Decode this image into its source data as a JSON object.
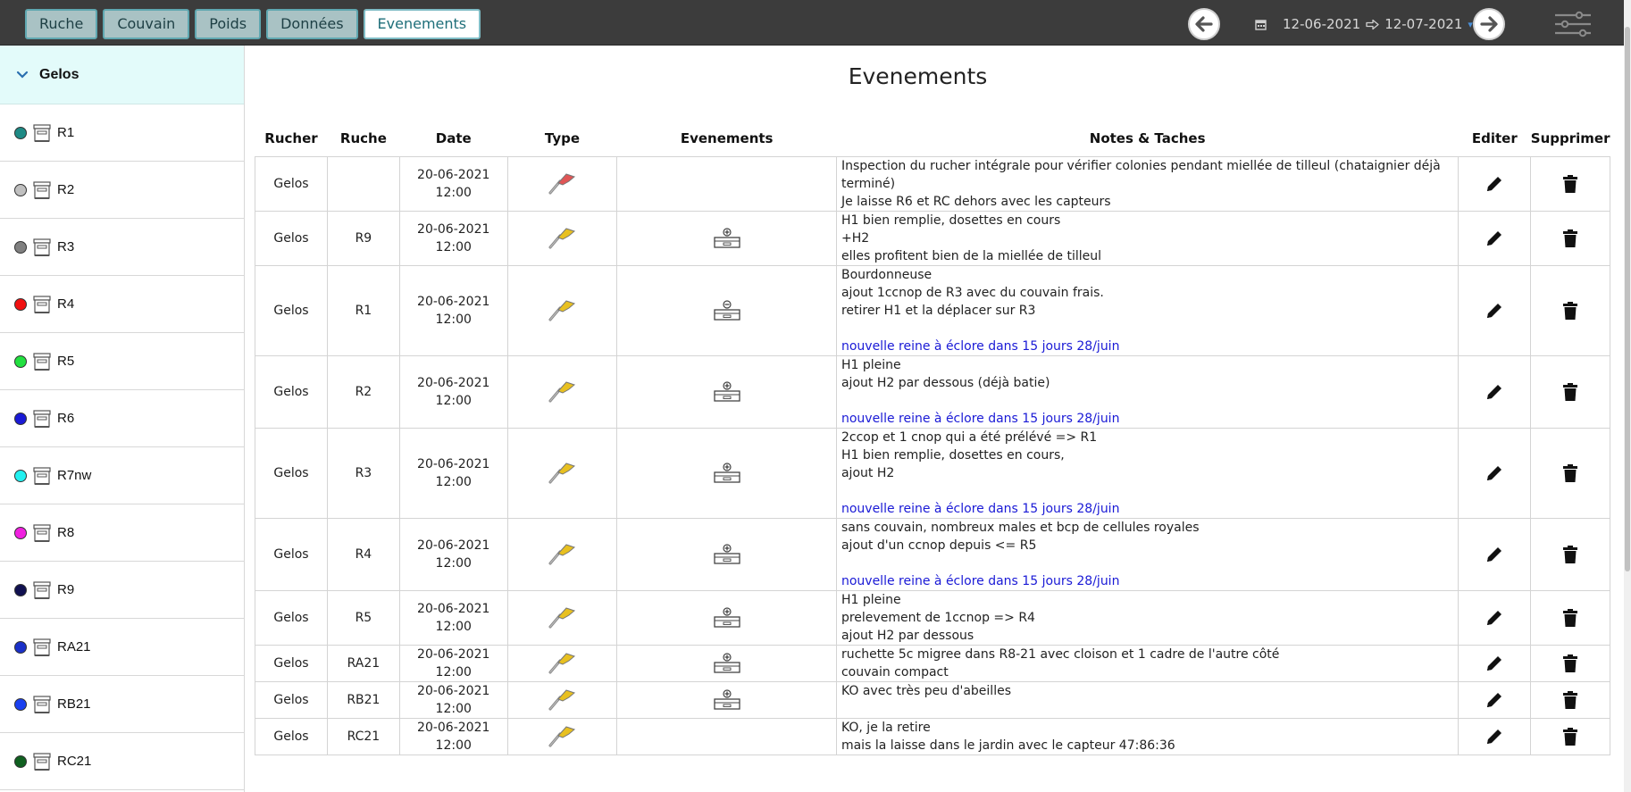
{
  "tabs": [
    {
      "label": "Ruche"
    },
    {
      "label": "Couvain"
    },
    {
      "label": "Poids"
    },
    {
      "label": "Données"
    },
    {
      "label": "Evenements"
    }
  ],
  "date_range": {
    "start": "12-06-2021",
    "end": "12-07-2021"
  },
  "sidebar": {
    "group": "Gelos",
    "hives": [
      {
        "label": "R1",
        "color": "#1e8a85"
      },
      {
        "label": "R2",
        "color": "#c0c0c0"
      },
      {
        "label": "R3",
        "color": "#808080"
      },
      {
        "label": "R4",
        "color": "#f01010"
      },
      {
        "label": "R5",
        "color": "#22e040"
      },
      {
        "label": "R6",
        "color": "#1a1ad6"
      },
      {
        "label": "R7nw",
        "color": "#22f0f0"
      },
      {
        "label": "R8",
        "color": "#f020e0"
      },
      {
        "label": "R9",
        "color": "#101050"
      },
      {
        "label": "RA21",
        "color": "#1a30c8"
      },
      {
        "label": "RB21",
        "color": "#1a40f0"
      },
      {
        "label": "RC21",
        "color": "#106020"
      }
    ]
  },
  "main": {
    "title": "Evenements",
    "columns": [
      "Rucher",
      "Ruche",
      "Date",
      "Type",
      "Evenements",
      "Notes & Taches",
      "Editer",
      "Supprimer"
    ],
    "rows": [
      {
        "rucher": "Gelos",
        "ruche": "",
        "date": "20-06-2021",
        "time": "12:00",
        "type_icon": "hive-tool-red-icon",
        "event_icon": "",
        "notes": [
          "Inspection du rucher intégrale pour vérifier colonies pendant miellée de tilleul (chataignier déjà terminé)",
          "Je laisse R6 et RC dehors avec les capteurs"
        ],
        "notes_link": ""
      },
      {
        "rucher": "Gelos",
        "ruche": "R9",
        "date": "20-06-2021",
        "time": "12:00",
        "type_icon": "hive-tool-yellow-icon",
        "event_icon": "add-super-icon",
        "notes": [
          "H1 bien remplie, dosettes en cours",
          "+H2",
          "elles profitent bien de la miellée de tilleul"
        ],
        "notes_link": ""
      },
      {
        "rucher": "Gelos",
        "ruche": "R1",
        "date": "20-06-2021",
        "time": "12:00",
        "type_icon": "hive-tool-yellow-icon",
        "event_icon": "remove-super-icon",
        "notes": [
          "Bourdonneuse",
          "ajout 1ccnop de R3 avec du couvain frais.",
          "retirer H1 et la déplacer sur R3",
          ""
        ],
        "notes_link": "nouvelle reine à éclore dans 15 jours 28/juin"
      },
      {
        "rucher": "Gelos",
        "ruche": "R2",
        "date": "20-06-2021",
        "time": "12:00",
        "type_icon": "hive-tool-yellow-icon",
        "event_icon": "add-super-icon",
        "notes": [
          "H1 pleine",
          "ajout H2 par dessous (déjà batie)",
          ""
        ],
        "notes_link": "nouvelle reine à éclore dans 15 jours 28/juin"
      },
      {
        "rucher": "Gelos",
        "ruche": "R3",
        "date": "20-06-2021",
        "time": "12:00",
        "type_icon": "hive-tool-yellow-icon",
        "event_icon": "add-super-icon",
        "notes": [
          "2ccop et 1 cnop qui a été prélévé => R1",
          "H1 bien remplie, dosettes en cours,",
          "ajout H2",
          ""
        ],
        "notes_link": "nouvelle reine à éclore dans 15 jours 28/juin"
      },
      {
        "rucher": "Gelos",
        "ruche": "R4",
        "date": "20-06-2021",
        "time": "12:00",
        "type_icon": "hive-tool-yellow-icon",
        "event_icon": "add-super-icon",
        "notes": [
          "sans couvain, nombreux males et bcp de cellules royales",
          "ajout d'un ccnop depuis <= R5",
          ""
        ],
        "notes_link": "nouvelle reine à éclore dans 15 jours 28/juin"
      },
      {
        "rucher": "Gelos",
        "ruche": "R5",
        "date": "20-06-2021",
        "time": "12:00",
        "type_icon": "hive-tool-yellow-icon",
        "event_icon": "add-super-icon",
        "notes": [
          "H1 pleine",
          "prelevement de 1ccnop => R4",
          "ajout H2 par dessous"
        ],
        "notes_link": ""
      },
      {
        "rucher": "Gelos",
        "ruche": "RA21",
        "date": "20-06-2021",
        "time": "12:00",
        "type_icon": "hive-tool-yellow-icon",
        "event_icon": "add-super-icon",
        "notes": [
          "ruchette 5c migree dans R8-21 avec cloison et 1 cadre de l'autre côté",
          "couvain compact"
        ],
        "notes_link": ""
      },
      {
        "rucher": "Gelos",
        "ruche": "RB21",
        "date": "20-06-2021",
        "time": "12:00",
        "type_icon": "hive-tool-yellow-icon",
        "event_icon": "add-super-icon",
        "notes": [
          "KO avec très peu d'abeilles"
        ],
        "notes_link": ""
      },
      {
        "rucher": "Gelos",
        "ruche": "RC21",
        "date": "20-06-2021",
        "time": "12:00",
        "type_icon": "hive-tool-yellow-icon",
        "event_icon": "",
        "notes": [
          "KO, je la retire",
          "mais la laisse dans le jardin avec le capteur 47:86:36"
        ],
        "notes_link": ""
      }
    ]
  }
}
